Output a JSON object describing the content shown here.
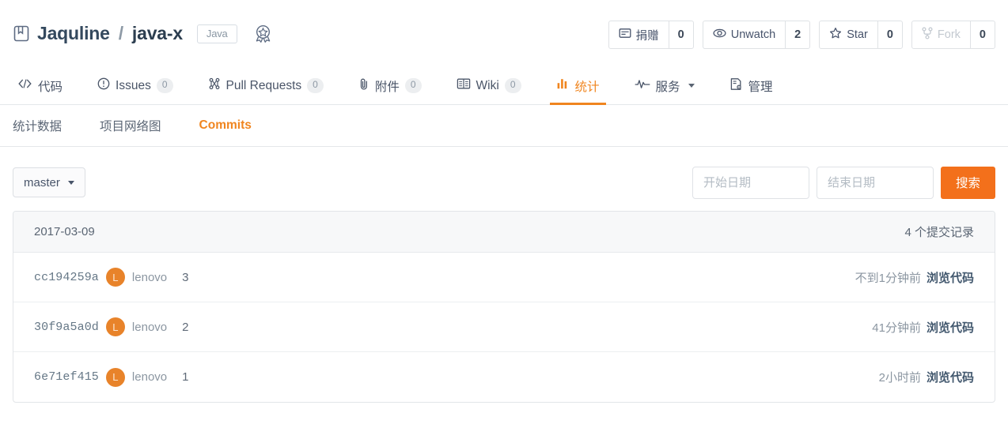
{
  "repo": {
    "icon": "book-icon",
    "owner": "Jaquline",
    "separator": "/",
    "name": "java-x",
    "language_badge": "Java",
    "award_icon": "award-badge-icon"
  },
  "actions": [
    {
      "id": "donate",
      "icon": "donate-icon",
      "label": "捐赠",
      "count": "0",
      "disabled": false
    },
    {
      "id": "unwatch",
      "icon": "eye-icon",
      "label": "Unwatch",
      "count": "2",
      "disabled": false
    },
    {
      "id": "star",
      "icon": "star-icon",
      "label": "Star",
      "count": "0",
      "disabled": false
    },
    {
      "id": "fork",
      "icon": "fork-icon",
      "label": "Fork",
      "count": "0",
      "disabled": true
    }
  ],
  "main_nav": [
    {
      "id": "code",
      "icon": "code-icon",
      "label": "代码",
      "count": null,
      "active": false,
      "caret": false
    },
    {
      "id": "issues",
      "icon": "issue-opened-icon",
      "label": "Issues",
      "count": "0",
      "active": false,
      "caret": false
    },
    {
      "id": "pull-requests",
      "icon": "git-pull-request-icon",
      "label": "Pull Requests",
      "count": "0",
      "active": false,
      "caret": false
    },
    {
      "id": "attachments",
      "icon": "paperclip-icon",
      "label": "附件",
      "count": "0",
      "active": false,
      "caret": false
    },
    {
      "id": "wiki",
      "icon": "book-open-icon",
      "label": "Wiki",
      "count": "0",
      "active": false,
      "caret": false
    },
    {
      "id": "stats",
      "icon": "bar-chart-icon",
      "label": "统计",
      "count": null,
      "active": true,
      "caret": false
    },
    {
      "id": "services",
      "icon": "pulse-icon",
      "label": "服务",
      "count": null,
      "active": false,
      "caret": true
    },
    {
      "id": "manage",
      "icon": "settings-doc-icon",
      "label": "管理",
      "count": null,
      "active": false,
      "caret": false
    }
  ],
  "sub_nav": [
    {
      "id": "stats-data",
      "label": "统计数据",
      "active": false
    },
    {
      "id": "network-graph",
      "label": "项目网络图",
      "active": false
    },
    {
      "id": "commits",
      "label": "Commits",
      "active": true
    }
  ],
  "filter": {
    "branch_label": "master",
    "start_date_placeholder": "开始日期",
    "start_date_value": "",
    "end_date_placeholder": "结束日期",
    "end_date_value": "",
    "search_label": "搜索"
  },
  "commits": {
    "day_label": "2017-03-09",
    "day_count": "4 个提交记录",
    "rows": [
      {
        "sha": "cc194259a",
        "avatar_letter": "L",
        "author": "lenovo",
        "message": "3",
        "rel_time": "不到1分钟前",
        "browse_label": "浏览代码"
      },
      {
        "sha": "30f9a5a0d",
        "avatar_letter": "L",
        "author": "lenovo",
        "message": "2",
        "rel_time": "41分钟前",
        "browse_label": "浏览代码"
      },
      {
        "sha": "6e71ef415",
        "avatar_letter": "L",
        "author": "lenovo",
        "message": "1",
        "rel_time": "2小时前",
        "browse_label": "浏览代码"
      }
    ]
  },
  "colors": {
    "accent": "#f3701b",
    "accent_tab": "#f0851f",
    "avatar_bg": "#e8832a",
    "text_primary": "#2c3e50",
    "text_muted": "#8b96a1",
    "border": "#e2e5e8"
  }
}
